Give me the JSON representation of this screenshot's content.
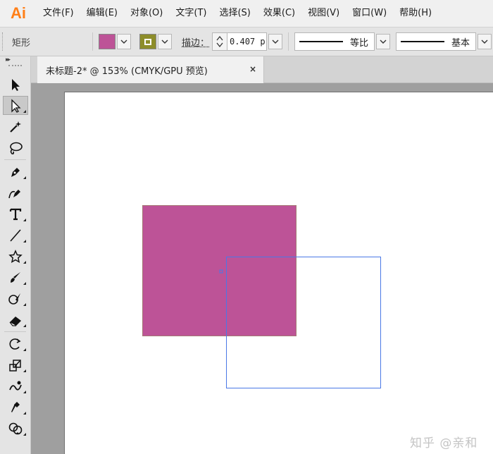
{
  "app": {
    "logo": "Ai"
  },
  "menu": [
    "文件(F)",
    "编辑(E)",
    "对象(O)",
    "文字(T)",
    "选择(S)",
    "效果(C)",
    "视图(V)",
    "窗口(W)",
    "帮助(H)"
  ],
  "control_bar": {
    "object_type": "矩形",
    "fill_color": "#bd5397",
    "stroke_color": "#8d8d2a",
    "stroke_label": "描边：",
    "stroke_weight": "0.407 p",
    "profile_1": "等比",
    "profile_2": "基本"
  },
  "tab": {
    "title": "未标题-2* @ 153% (CMYK/GPU 预览)",
    "close": "×"
  },
  "toolbar": {
    "collapse": "▸▸",
    "tools": [
      "selection-tool",
      "direct-selection-tool",
      "magic-wand-tool",
      "lasso-tool",
      "pen-tool",
      "curvature-tool",
      "type-tool",
      "line-segment-tool",
      "star-tool",
      "paintbrush-tool",
      "shaper-tool",
      "eraser-tool",
      "rotate-tool",
      "scale-tool",
      "warp-tool",
      "puppet-warp-tool",
      "shape-builder-tool"
    ]
  },
  "canvas": {
    "watermark": "知乎 @亲和"
  }
}
